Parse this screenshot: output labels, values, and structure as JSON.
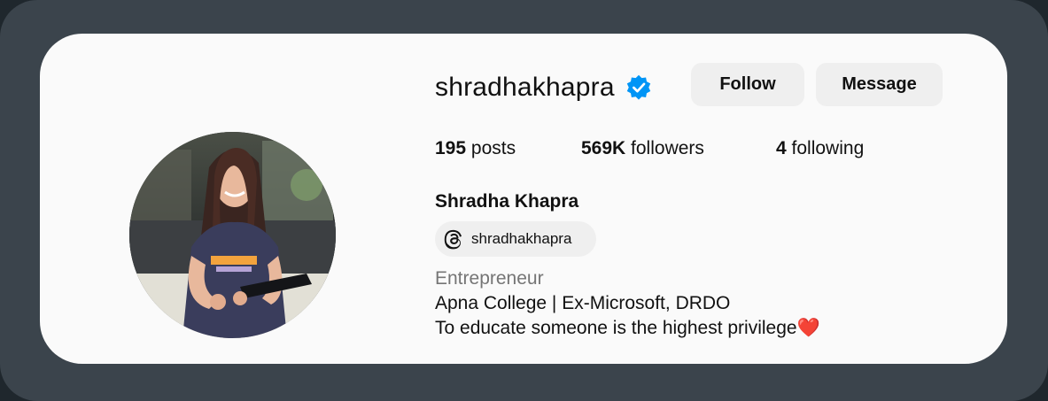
{
  "profile": {
    "username": "shradhakhapra",
    "verified_icon": "verified-badge-icon",
    "avatar_icon": "profile-photo",
    "follow_label": "Follow",
    "message_label": "Message",
    "stats": {
      "posts_count": "195",
      "posts_label": "posts",
      "followers_count": "569K",
      "followers_label": "followers",
      "following_count": "4",
      "following_label": "following"
    },
    "full_name": "Shradha Khapra",
    "threads_handle": "shradhakhapra",
    "threads_icon": "threads-icon",
    "category": "Entrepreneur",
    "bio": [
      "Apna College | Ex-Microsoft, DRDO",
      "To educate someone is the highest privilege❤️"
    ]
  },
  "colors": {
    "verified_blue": "#0095f6",
    "button_bg": "#efefef",
    "card_bg": "#fafafa",
    "frame_bg": "#3b444c",
    "category_gray": "#757575"
  }
}
